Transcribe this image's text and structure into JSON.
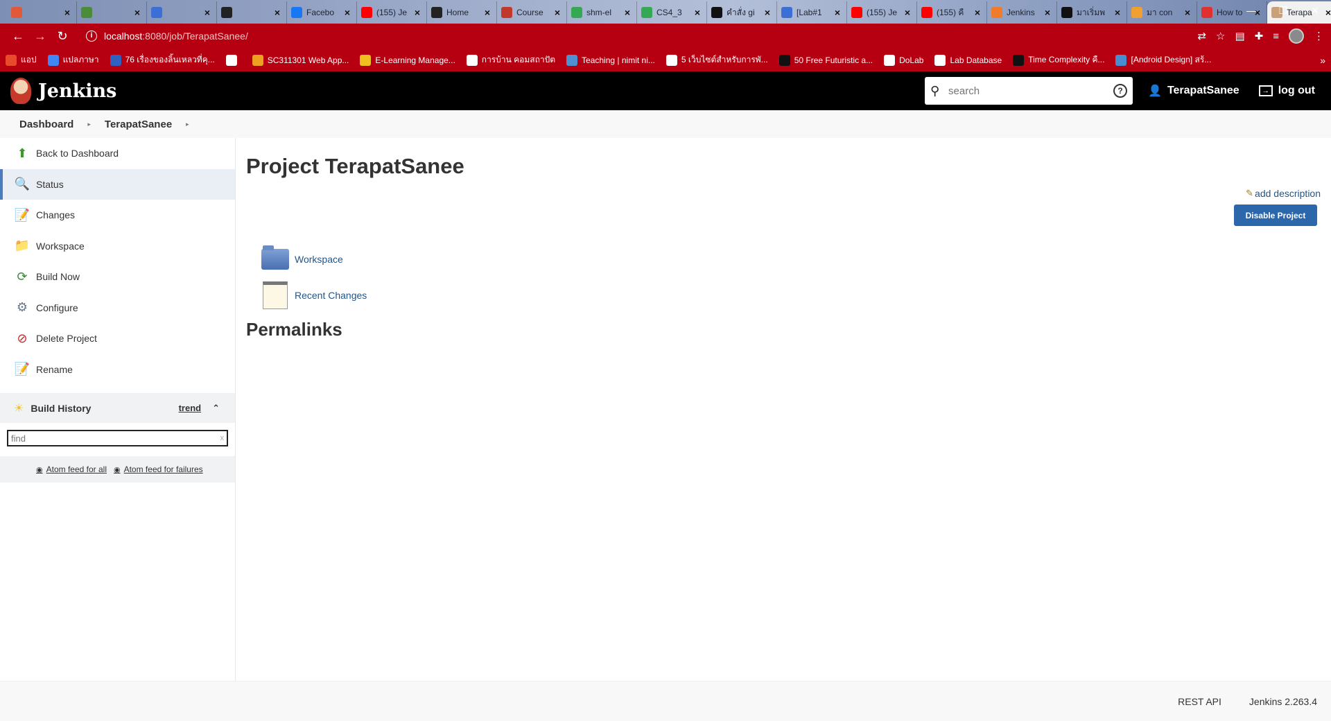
{
  "browser": {
    "tabs": [
      {
        "title": "",
        "color": "#e05a3a"
      },
      {
        "title": "",
        "color": "#4a8c3a"
      },
      {
        "title": "",
        "color": "#3b6fd6"
      },
      {
        "title": "",
        "color": "#222222"
      },
      {
        "title": "Facebo",
        "color": "#1877f2"
      },
      {
        "title": "(155) Je",
        "color": "#ff0000"
      },
      {
        "title": "Home",
        "color": "#222222"
      },
      {
        "title": "Course",
        "color": "#c0392b"
      },
      {
        "title": "shm-el",
        "color": "#34a853"
      },
      {
        "title": "CS4_3",
        "color": "#34a853"
      },
      {
        "title": "คำสั่ง gi",
        "color": "#111111"
      },
      {
        "title": "[Lab#1",
        "color": "#3b6fd6"
      },
      {
        "title": "(155) Je",
        "color": "#ff0000"
      },
      {
        "title": "(155) คื",
        "color": "#ff0000"
      },
      {
        "title": "Jenkins",
        "color": "#f07b2b"
      },
      {
        "title": "มาเริ่มพ",
        "color": "#111111"
      },
      {
        "title": "มา con",
        "color": "#f0a030"
      },
      {
        "title": "How to",
        "color": "#e03030"
      },
      {
        "title": "Terapa",
        "color": "#c8a07a",
        "active": true
      }
    ],
    "url_host": "localhost",
    "url_path": ":8080/job/TerapatSanee/",
    "bookmarks": [
      {
        "label": "แอป",
        "color": "#e84a2a"
      },
      {
        "label": "แปลภาษา",
        "color": "#4285f4"
      },
      {
        "label": "76 เรื่องของลิ้นเหลวที่คุ...",
        "color": "#3060c0"
      },
      {
        "label": "",
        "color": "#ffffff"
      },
      {
        "label": "SC311301 Web App...",
        "color": "#f0a020"
      },
      {
        "label": "E-Learning Manage...",
        "color": "#f0c020"
      },
      {
        "label": "การบ้าน คอมสถาปัต",
        "color": "#ffffff"
      },
      {
        "label": "Teaching | nimit ni...",
        "color": "#5090d0"
      },
      {
        "label": "5 เว็บไซต์สำหรับการพั...",
        "color": "#ffffff"
      },
      {
        "label": "50 Free Futuristic a...",
        "color": "#111111"
      },
      {
        "label": "DoLab",
        "color": "#ffffff"
      },
      {
        "label": "Lab Database",
        "color": "#ffffff"
      },
      {
        "label": "Time Complexity คื...",
        "color": "#111111"
      },
      {
        "label": "[Android Design] สร้...",
        "color": "#4a8cd0"
      }
    ]
  },
  "header": {
    "app_title": "Jenkins",
    "search_placeholder": "search",
    "help": "?",
    "user": "TerapatSanee",
    "logout": "log out"
  },
  "breadcrumb": [
    "Dashboard",
    "TerapatSanee"
  ],
  "sidebar": {
    "tasks": [
      {
        "label": "Back to Dashboard",
        "icon": "up-arrow-icon",
        "glyph": "⬆",
        "color": "#3c9a2a"
      },
      {
        "label": "Status",
        "icon": "search-icon",
        "glyph": "🔍",
        "color": "#555555",
        "selected": true
      },
      {
        "label": "Changes",
        "icon": "notepad-icon",
        "glyph": "📝",
        "color": "#8a6a20"
      },
      {
        "label": "Workspace",
        "icon": "folder-icon",
        "glyph": "📁",
        "color": "#4a6fb0"
      },
      {
        "label": "Build Now",
        "icon": "build-clock-icon",
        "glyph": "⟳",
        "color": "#3c8a3a"
      },
      {
        "label": "Configure",
        "icon": "gear-icon",
        "glyph": "⚙",
        "color": "#667788"
      },
      {
        "label": "Delete Project",
        "icon": "no-entry-icon",
        "glyph": "⊘",
        "color": "#cc2222"
      },
      {
        "label": "Rename",
        "icon": "notepad-icon",
        "glyph": "📝",
        "color": "#8a6a20"
      }
    ],
    "build_history": {
      "title": "Build History",
      "trend": "trend",
      "find_placeholder": "find",
      "clear": "x"
    },
    "feeds": [
      "Atom feed for all",
      "Atom feed for failures"
    ]
  },
  "main": {
    "title": "Project TerapatSanee",
    "add_description": "add description",
    "disable_button": "Disable Project",
    "links": [
      "Workspace",
      "Recent Changes"
    ],
    "permalinks_heading": "Permalinks"
  },
  "footer": {
    "rest_api": "REST API",
    "version": "Jenkins 2.263.4"
  }
}
